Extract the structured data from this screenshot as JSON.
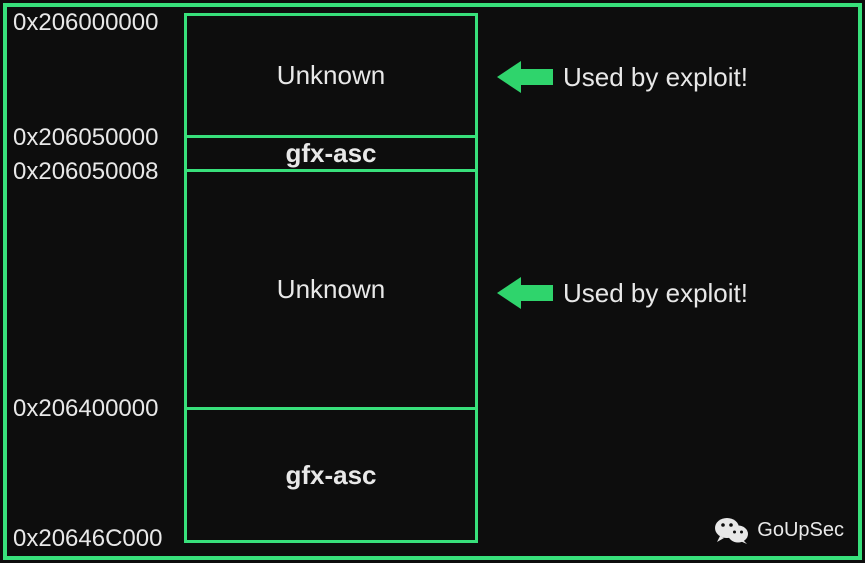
{
  "addresses": {
    "a0": "0x206000000",
    "a1": "0x206050000",
    "a2": "0x206050008",
    "a3": "0x206400000",
    "a4": "0x20646C000"
  },
  "regions": {
    "r0": "Unknown",
    "r1": "gfx-asc",
    "r2": "Unknown",
    "r3": "gfx-asc"
  },
  "annotations": {
    "ann0": "Used by exploit!",
    "ann1": "Used by exploit!"
  },
  "watermark": "GoUpSec"
}
